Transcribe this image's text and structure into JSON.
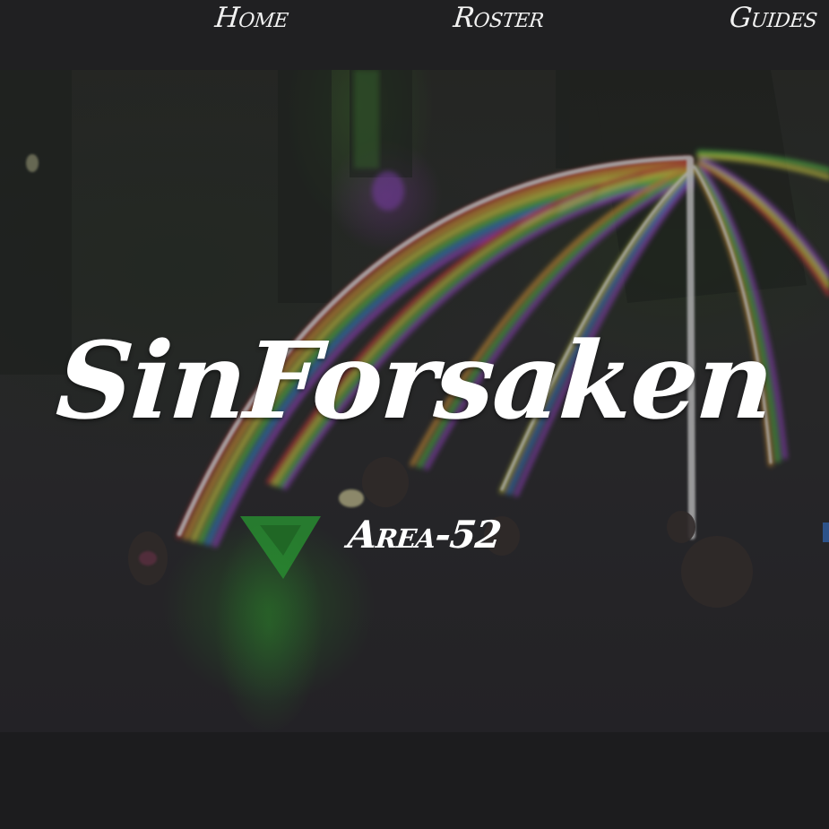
{
  "nav": {
    "home_label": "Home",
    "roster_label": "Roster",
    "guides_label": "Guides"
  },
  "hero": {
    "title": "SinForsaken",
    "subtitle": "Area-52"
  },
  "colors": {
    "nav_background": "#202022",
    "page_background": "#1b1b1d",
    "text": "#ffffff"
  }
}
